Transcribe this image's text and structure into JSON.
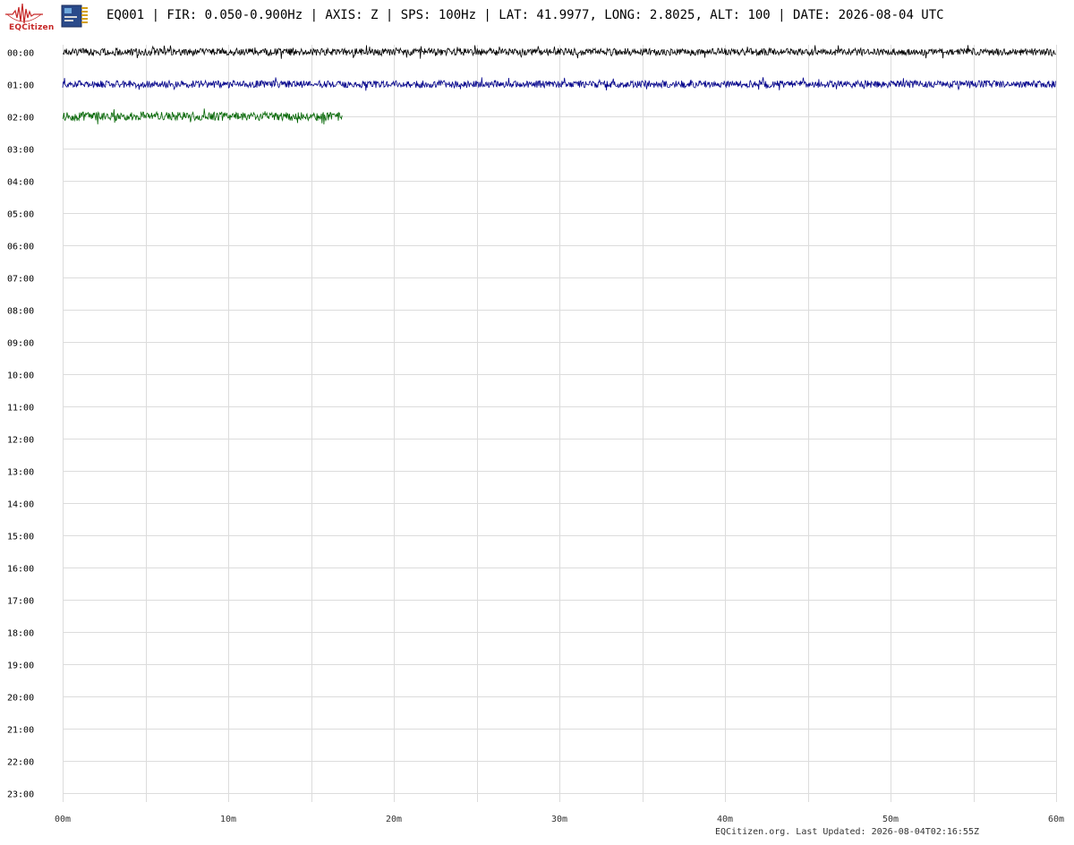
{
  "header": {
    "logo_text": "EQCitizen",
    "title": "EQ001 | FIR: 0.050-0.900Hz | AXIS: Z | SPS: 100Hz | LAT: 41.9977, LONG: 2.8025, ALT: 100 | DATE: 2026-08-04 UTC"
  },
  "footer": {
    "text": "EQCitizen.org. Last Updated: 2026-08-04T02:16:55Z"
  },
  "chart_data": {
    "type": "line",
    "title": "",
    "xlabel": "",
    "ylabel": "",
    "x_ticks": [
      "00m",
      "10m",
      "20m",
      "30m",
      "40m",
      "50m",
      "60m"
    ],
    "x_range_minutes": [
      0,
      60
    ],
    "minor_gridline_every_minutes": 5,
    "y_ticks": [
      "00:00",
      "01:00",
      "02:00",
      "03:00",
      "04:00",
      "05:00",
      "06:00",
      "07:00",
      "08:00",
      "09:00",
      "10:00",
      "11:00",
      "12:00",
      "13:00",
      "14:00",
      "15:00",
      "16:00",
      "17:00",
      "18:00",
      "19:00",
      "20:00",
      "21:00",
      "22:00",
      "23:00"
    ],
    "grid": true,
    "series": [
      {
        "hour": "00:00",
        "start_minute": 0,
        "end_minute": 60,
        "color": "#000000",
        "noise_amplitude": 0.45
      },
      {
        "hour": "01:00",
        "start_minute": 0,
        "end_minute": 60,
        "color": "#00008b",
        "noise_amplitude": 0.45
      },
      {
        "hour": "02:00",
        "start_minute": 0,
        "end_minute": 16.9,
        "color": "#006400",
        "noise_amplitude": 0.55
      }
    ]
  }
}
